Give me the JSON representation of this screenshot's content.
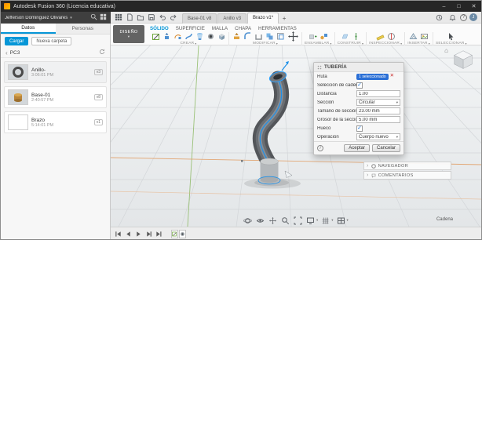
{
  "window": {
    "title": "Autodesk Fusion 360 (Licencia educativa)"
  },
  "icons": {
    "minimize": "–",
    "maximize": "□",
    "close": "✕",
    "caret": "▾",
    "chevron_left": "‹",
    "chevron_right": "›",
    "plus": "+",
    "help": "?",
    "info": "i",
    "check": "✓",
    "remove": "✕",
    "home": "⌂",
    "avatar_initial": "J"
  },
  "data_panel": {
    "account": "Jefferson Dominguez Olivares",
    "tabs": [
      {
        "label": "Datos"
      },
      {
        "label": "Personas"
      }
    ],
    "upload_label": "Cargar",
    "new_folder_label": "Nueva carpeta",
    "project": "PC3",
    "items": [
      {
        "name": "Anillo-",
        "time": "3:06:01 PM",
        "version": "v3"
      },
      {
        "name": "Base-01",
        "time": "2:40:57 PM",
        "version": "v8"
      },
      {
        "name": "Brazo",
        "time": "5:14:01 PM",
        "version": "v1"
      }
    ]
  },
  "appbar": {
    "doc_tabs": [
      {
        "label": "Base-01 v8"
      },
      {
        "label": "Anillo v3"
      },
      {
        "label": "Brazo v1*"
      }
    ]
  },
  "ribbon": {
    "workspace": "DISEÑO",
    "tabs": [
      "SÓLIDO",
      "SUPERFICIE",
      "MALLA",
      "CHAPA",
      "HERRAMIENTAS"
    ],
    "active_tab": "SÓLIDO",
    "groups": [
      "CREAR",
      "MODIFICAR",
      "ENSAMBLAR",
      "CONSTRUIR",
      "INSPECCIONAR",
      "INSERTAR",
      "SELECCIONAR"
    ]
  },
  "viewport": {
    "selection_hint": "Cadena"
  },
  "side_panels": [
    {
      "label": "NAVEGADOR"
    },
    {
      "label": "COMENTARIOS"
    }
  ],
  "dialog": {
    "title": "TUBERÍA",
    "fields": {
      "ruta_label": "Ruta",
      "ruta_badge": "1 seleccionado",
      "cadena_label": "Selección de cadena",
      "distancia_label": "Distancia",
      "distancia_value": "1.00",
      "seccion_label": "Sección",
      "seccion_value": "Circular",
      "tamano_label": "Tamaño de sección",
      "tamano_value": "23.00 mm",
      "grosor_label": "Grosor de la sección",
      "grosor_value": "5.00 mm",
      "hueco_label": "Hueco",
      "operacion_label": "Operación",
      "operacion_value": "Cuerpo nuevo"
    },
    "ok_label": "Aceptar",
    "cancel_label": "Cancelar"
  },
  "colors": {
    "accent_blue": "#0696d7",
    "selection_blue": "#1e90e8",
    "badge_blue": "#2a6fd6",
    "tube_gray": "#56595d"
  }
}
